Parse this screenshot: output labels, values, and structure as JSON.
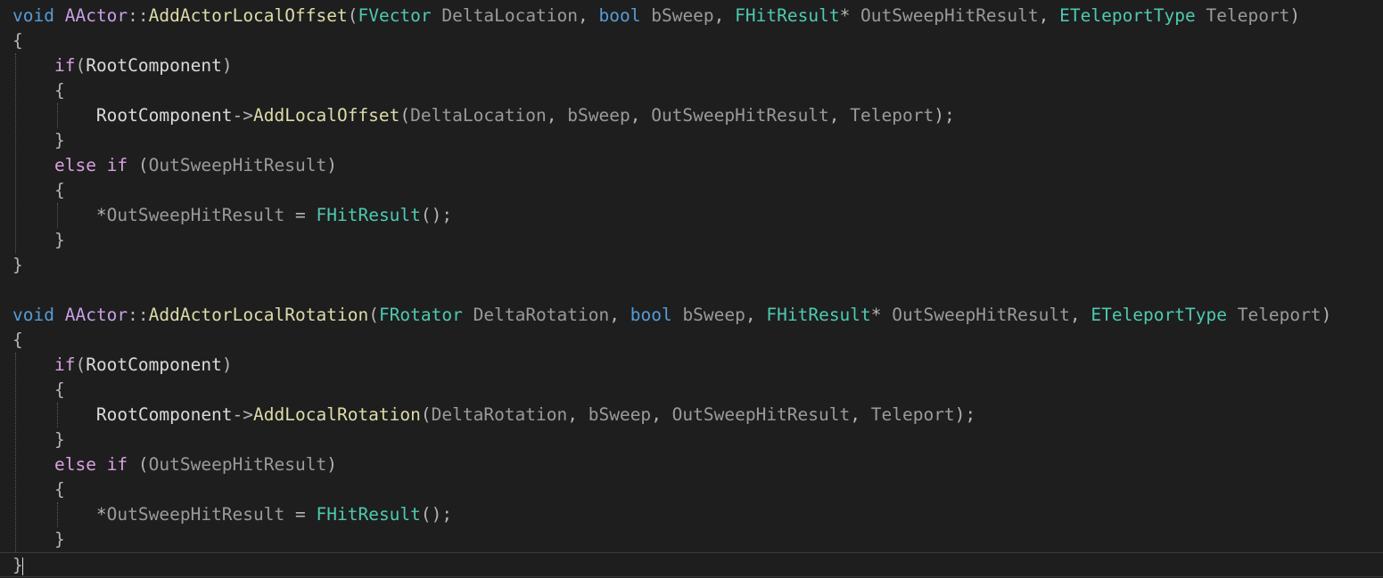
{
  "editor": {
    "theme_colors": {
      "background": "#1e1e1e",
      "keyword": "#569cd6",
      "control_keyword": "#d8a0df",
      "function": "#dcdcaa",
      "type": "#4ec9b0",
      "parameter": "#9a9a9a",
      "text": "#dcdcdc"
    },
    "cursor_line": 23,
    "lines": [
      [
        {
          "t": "void",
          "c": "kw"
        },
        {
          "t": " ",
          "c": "var"
        },
        {
          "t": "AActor",
          "c": "cls"
        },
        {
          "t": "::",
          "c": "punc"
        },
        {
          "t": "AddActorLocalOffset",
          "c": "fn"
        },
        {
          "t": "(",
          "c": "punc"
        },
        {
          "t": "FVector",
          "c": "typ"
        },
        {
          "t": " DeltaLocation",
          "c": "param"
        },
        {
          "t": ", ",
          "c": "punc"
        },
        {
          "t": "bool",
          "c": "kw"
        },
        {
          "t": " bSweep",
          "c": "param"
        },
        {
          "t": ", ",
          "c": "punc"
        },
        {
          "t": "FHitResult",
          "c": "typ"
        },
        {
          "t": "*",
          "c": "punc"
        },
        {
          "t": " OutSweepHitResult",
          "c": "param"
        },
        {
          "t": ", ",
          "c": "punc"
        },
        {
          "t": "ETeleportType",
          "c": "typ"
        },
        {
          "t": " Teleport",
          "c": "param"
        },
        {
          "t": ")",
          "c": "punc"
        }
      ],
      [
        {
          "t": "{",
          "c": "punc"
        }
      ],
      [
        {
          "t": "    ",
          "c": "var"
        },
        {
          "t": "if",
          "c": "ctl"
        },
        {
          "t": "(",
          "c": "punc"
        },
        {
          "t": "RootComponent",
          "c": "var"
        },
        {
          "t": ")",
          "c": "punc"
        }
      ],
      [
        {
          "t": "    ",
          "c": "var"
        },
        {
          "t": "{",
          "c": "punc"
        }
      ],
      [
        {
          "t": "        ",
          "c": "var"
        },
        {
          "t": "RootComponent",
          "c": "var"
        },
        {
          "t": "->",
          "c": "punc"
        },
        {
          "t": "AddLocalOffset",
          "c": "fn"
        },
        {
          "t": "(",
          "c": "punc"
        },
        {
          "t": "DeltaLocation",
          "c": "param"
        },
        {
          "t": ", ",
          "c": "punc"
        },
        {
          "t": "bSweep",
          "c": "param"
        },
        {
          "t": ", ",
          "c": "punc"
        },
        {
          "t": "OutSweepHitResult",
          "c": "param"
        },
        {
          "t": ", ",
          "c": "punc"
        },
        {
          "t": "Teleport",
          "c": "param"
        },
        {
          "t": ");",
          "c": "punc"
        }
      ],
      [
        {
          "t": "    ",
          "c": "var"
        },
        {
          "t": "}",
          "c": "punc"
        }
      ],
      [
        {
          "t": "    ",
          "c": "var"
        },
        {
          "t": "else",
          "c": "ctl"
        },
        {
          "t": " ",
          "c": "var"
        },
        {
          "t": "if",
          "c": "ctl"
        },
        {
          "t": " (",
          "c": "punc"
        },
        {
          "t": "OutSweepHitResult",
          "c": "param"
        },
        {
          "t": ")",
          "c": "punc"
        }
      ],
      [
        {
          "t": "    ",
          "c": "var"
        },
        {
          "t": "{",
          "c": "punc"
        }
      ],
      [
        {
          "t": "        ",
          "c": "var"
        },
        {
          "t": "*",
          "c": "punc"
        },
        {
          "t": "OutSweepHitResult",
          "c": "param"
        },
        {
          "t": " = ",
          "c": "punc"
        },
        {
          "t": "FHitResult",
          "c": "typ"
        },
        {
          "t": "();",
          "c": "punc"
        }
      ],
      [
        {
          "t": "    ",
          "c": "var"
        },
        {
          "t": "}",
          "c": "punc"
        }
      ],
      [
        {
          "t": "}",
          "c": "punc"
        }
      ],
      [],
      [
        {
          "t": "void",
          "c": "kw"
        },
        {
          "t": " ",
          "c": "var"
        },
        {
          "t": "AActor",
          "c": "cls"
        },
        {
          "t": "::",
          "c": "punc"
        },
        {
          "t": "AddActorLocalRotation",
          "c": "fn"
        },
        {
          "t": "(",
          "c": "punc"
        },
        {
          "t": "FRotator",
          "c": "typ"
        },
        {
          "t": " DeltaRotation",
          "c": "param"
        },
        {
          "t": ", ",
          "c": "punc"
        },
        {
          "t": "bool",
          "c": "kw"
        },
        {
          "t": " bSweep",
          "c": "param"
        },
        {
          "t": ", ",
          "c": "punc"
        },
        {
          "t": "FHitResult",
          "c": "typ"
        },
        {
          "t": "*",
          "c": "punc"
        },
        {
          "t": " OutSweepHitResult",
          "c": "param"
        },
        {
          "t": ", ",
          "c": "punc"
        },
        {
          "t": "ETeleportType",
          "c": "typ"
        },
        {
          "t": " Teleport",
          "c": "param"
        },
        {
          "t": ")",
          "c": "punc"
        }
      ],
      [
        {
          "t": "{",
          "c": "punc"
        }
      ],
      [
        {
          "t": "    ",
          "c": "var"
        },
        {
          "t": "if",
          "c": "ctl"
        },
        {
          "t": "(",
          "c": "punc"
        },
        {
          "t": "RootComponent",
          "c": "var"
        },
        {
          "t": ")",
          "c": "punc"
        }
      ],
      [
        {
          "t": "    ",
          "c": "var"
        },
        {
          "t": "{",
          "c": "punc"
        }
      ],
      [
        {
          "t": "        ",
          "c": "var"
        },
        {
          "t": "RootComponent",
          "c": "var"
        },
        {
          "t": "->",
          "c": "punc"
        },
        {
          "t": "AddLocalRotation",
          "c": "fn"
        },
        {
          "t": "(",
          "c": "punc"
        },
        {
          "t": "DeltaRotation",
          "c": "param"
        },
        {
          "t": ", ",
          "c": "punc"
        },
        {
          "t": "bSweep",
          "c": "param"
        },
        {
          "t": ", ",
          "c": "punc"
        },
        {
          "t": "OutSweepHitResult",
          "c": "param"
        },
        {
          "t": ", ",
          "c": "punc"
        },
        {
          "t": "Teleport",
          "c": "param"
        },
        {
          "t": ");",
          "c": "punc"
        }
      ],
      [
        {
          "t": "    ",
          "c": "var"
        },
        {
          "t": "}",
          "c": "punc"
        }
      ],
      [
        {
          "t": "    ",
          "c": "var"
        },
        {
          "t": "else",
          "c": "ctl"
        },
        {
          "t": " ",
          "c": "var"
        },
        {
          "t": "if",
          "c": "ctl"
        },
        {
          "t": " (",
          "c": "punc"
        },
        {
          "t": "OutSweepHitResult",
          "c": "param"
        },
        {
          "t": ")",
          "c": "punc"
        }
      ],
      [
        {
          "t": "    ",
          "c": "var"
        },
        {
          "t": "{",
          "c": "punc"
        }
      ],
      [
        {
          "t": "        ",
          "c": "var"
        },
        {
          "t": "*",
          "c": "punc"
        },
        {
          "t": "OutSweepHitResult",
          "c": "param"
        },
        {
          "t": " = ",
          "c": "punc"
        },
        {
          "t": "FHitResult",
          "c": "typ"
        },
        {
          "t": "();",
          "c": "punc"
        }
      ],
      [
        {
          "t": "    ",
          "c": "var"
        },
        {
          "t": "}",
          "c": "punc"
        }
      ],
      [
        {
          "t": "}",
          "c": "punc"
        }
      ]
    ]
  }
}
